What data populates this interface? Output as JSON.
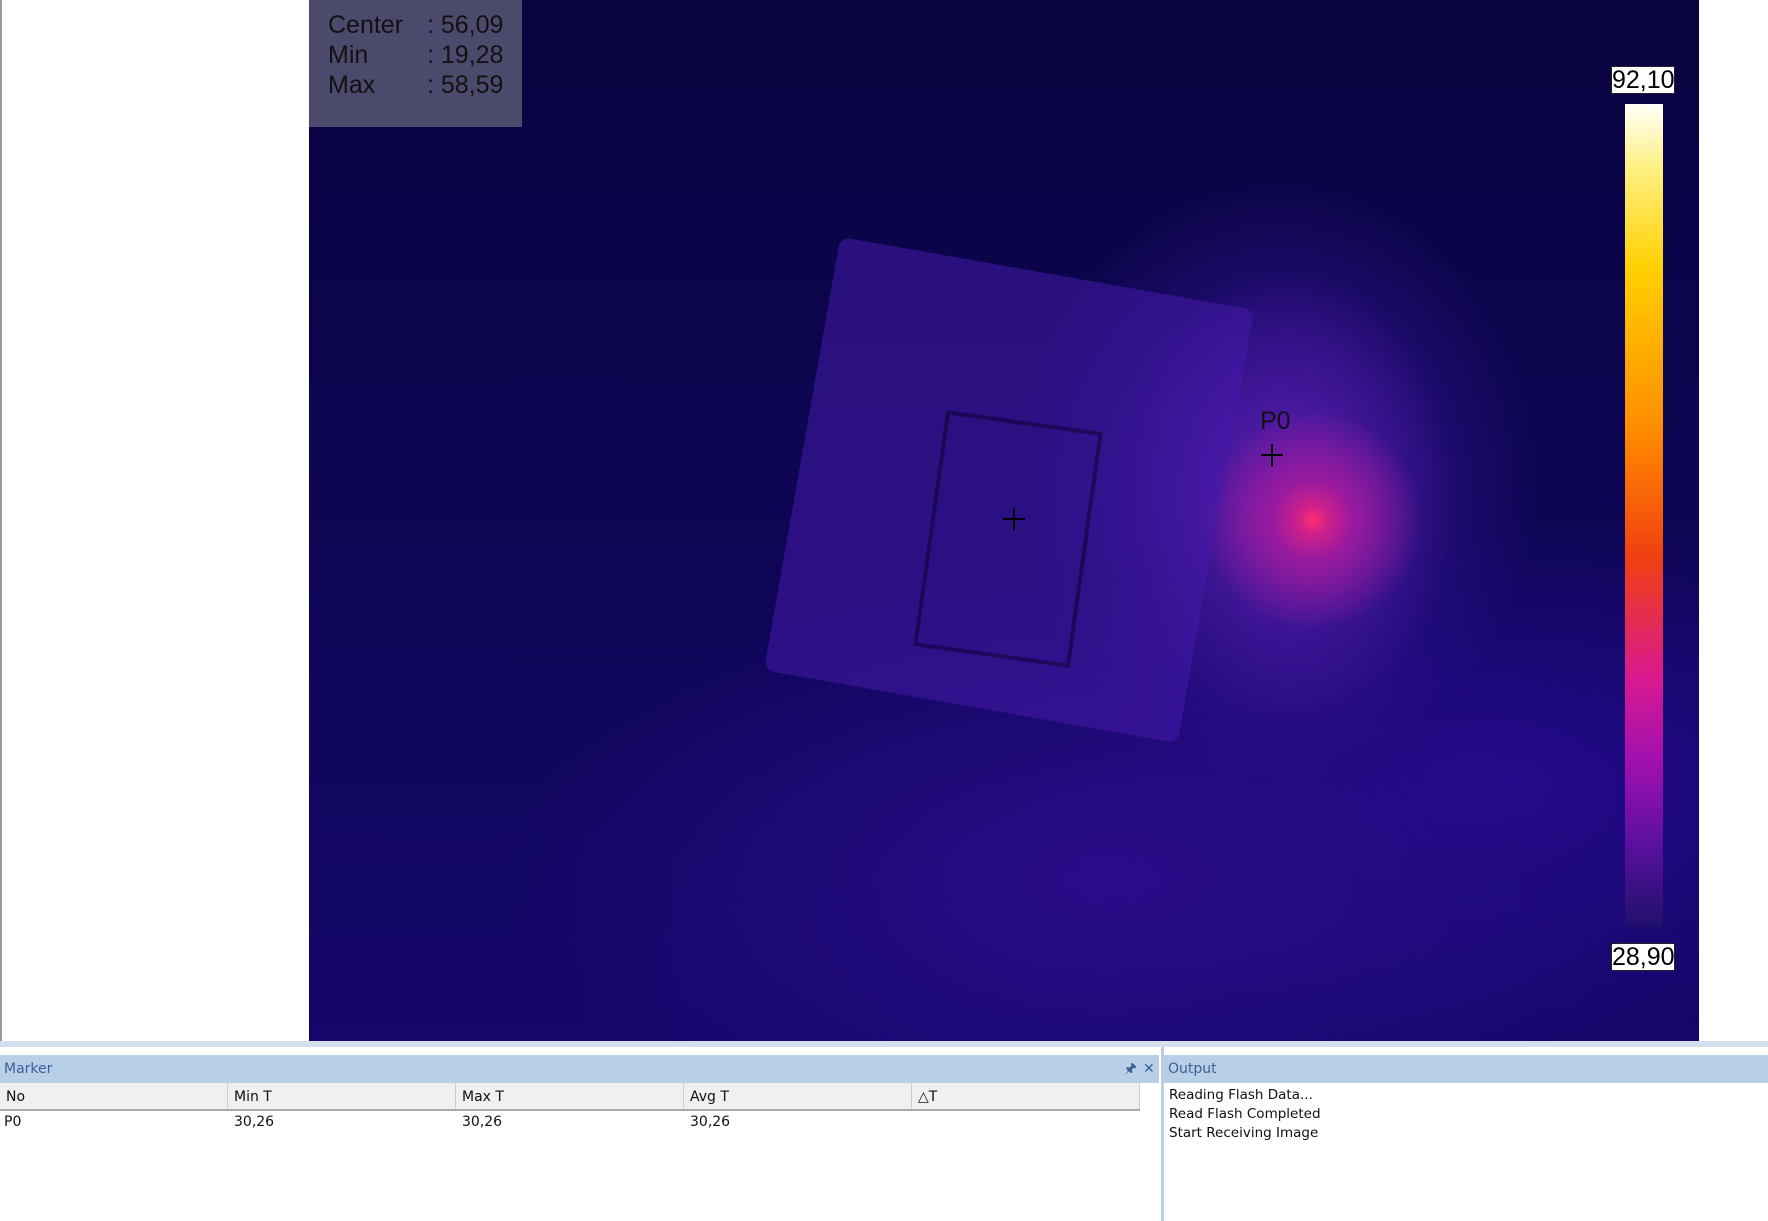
{
  "overlay": {
    "center_label": "Center",
    "center_value": ": 56,09",
    "min_label": "Min",
    "min_value": ": 19,28",
    "max_label": "Max",
    "max_value": ": 58,59"
  },
  "markers_on_image": {
    "p0_label": "P0"
  },
  "scale": {
    "max": "92,10",
    "min": "28,90",
    "palette": "iron"
  },
  "marker_panel": {
    "title": "Marker",
    "pin_icon": "pin-icon",
    "close_icon": "close-icon",
    "columns": [
      "No",
      "Min T",
      "Max T",
      "Avg T",
      "△T"
    ],
    "rows": [
      {
        "no": "P0",
        "min": "30,26",
        "max": "30,26",
        "avg": "30,26",
        "delta": ""
      }
    ]
  },
  "output_panel": {
    "title": "Output",
    "lines": [
      "Reading Flash Data...",
      "Read Flash Completed",
      "Start Receiving Image"
    ]
  }
}
